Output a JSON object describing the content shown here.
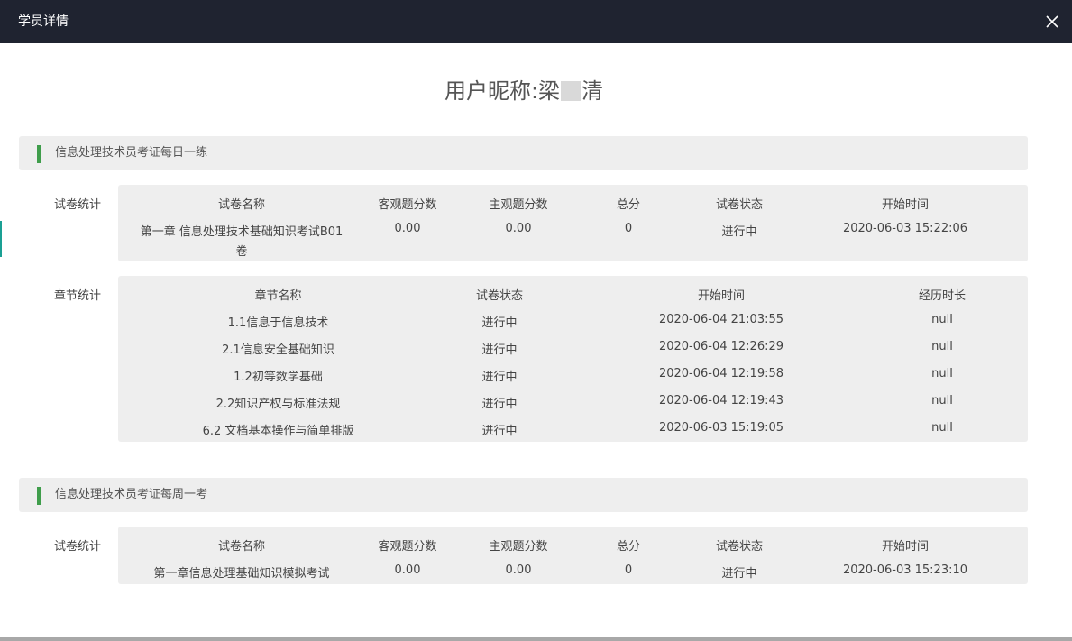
{
  "window": {
    "title": "学员详情"
  },
  "heading": {
    "prefix": "用户昵称:梁",
    "suffix": "清"
  },
  "sections": [
    {
      "label": "信息处理技术员考证每日一练",
      "paper_stats": {
        "label": "试卷统计",
        "headers": [
          "试卷名称",
          "客观题分数",
          "主观题分数",
          "总分",
          "试卷状态",
          "开始时间"
        ],
        "rows": [
          {
            "name_line1": "第一章 信息处理技术基础知识考试B01",
            "name_line2": "卷",
            "objective": "0.00",
            "subjective": "0.00",
            "total": "0",
            "state": "进行中",
            "start": "2020-06-03 15:22:06"
          }
        ]
      },
      "chapter_stats": {
        "label": "章节统计",
        "headers": [
          "章节名称",
          "试卷状态",
          "开始时间",
          "经历时长"
        ],
        "rows": [
          {
            "name": "1.1信息于信息技术",
            "state": "进行中",
            "start": "2020-06-04 21:03:55",
            "duration": "null"
          },
          {
            "name": "2.1信息安全基础知识",
            "state": "进行中",
            "start": "2020-06-04 12:26:29",
            "duration": "null"
          },
          {
            "name": "1.2初等数学基础",
            "state": "进行中",
            "start": "2020-06-04 12:19:58",
            "duration": "null"
          },
          {
            "name": "2.2知识产权与标准法规",
            "state": "进行中",
            "start": "2020-06-04 12:19:43",
            "duration": "null"
          },
          {
            "name": "6.2 文档基本操作与简单排版",
            "state": "进行中",
            "start": "2020-06-03 15:19:05",
            "duration": "null"
          }
        ]
      }
    },
    {
      "label": "信息处理技术员考证每周一考",
      "paper_stats": {
        "label": "试卷统计",
        "headers": [
          "试卷名称",
          "客观题分数",
          "主观题分数",
          "总分",
          "试卷状态",
          "开始时间"
        ],
        "rows": [
          {
            "name_line1": "第一章信息处理基础知识模拟考试",
            "objective": "0.00",
            "subjective": "0.00",
            "total": "0",
            "state": "进行中",
            "start": "2020-06-03 15:23:10"
          }
        ]
      }
    }
  ],
  "icons": {
    "close": "close-icon"
  },
  "colors": {
    "titlebar": "#1f2330",
    "accent_stripe": "#3f9d4b",
    "panel": "#eeeeee"
  }
}
